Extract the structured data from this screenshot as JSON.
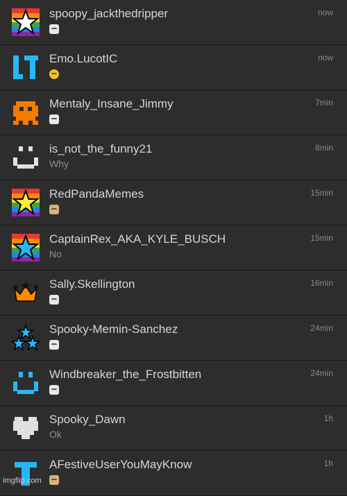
{
  "conversations": [
    {
      "name": "spoopy_jackthedripper",
      "preview": "",
      "preview_emoji": "face-emoji",
      "time": "now",
      "avatar": "rainbow-star-white-icon"
    },
    {
      "name": "Emo.LucotIC",
      "preview": "",
      "preview_emoji": "kiss-emoji",
      "time": "now",
      "avatar": "lt-letters-icon"
    },
    {
      "name": "Mentaly_Insane_Jimmy",
      "preview": "",
      "preview_emoji": "face-emoji",
      "time": "7min",
      "avatar": "orange-ghost-icon"
    },
    {
      "name": "is_not_the_funny21",
      "preview": "Why",
      "preview_emoji": "",
      "time": "8min",
      "avatar": "smile-face-icon"
    },
    {
      "name": "RedPandaMemes",
      "preview": "",
      "preview_emoji": "dog-emoji",
      "time": "15min",
      "avatar": "rainbow-star-yellow-icon"
    },
    {
      "name": "CaptainRex_AKA_KYLE_BUSCH",
      "preview": "No",
      "preview_emoji": "",
      "time": "15min",
      "avatar": "rainbow-star-blue-icon"
    },
    {
      "name": "Sally.Skellington",
      "preview": "",
      "preview_emoji": "face-emoji",
      "time": "16min",
      "avatar": "crown-icon"
    },
    {
      "name": "Spooky-Memin-Sanchez",
      "preview": "",
      "preview_emoji": "face-emoji",
      "time": "24min",
      "avatar": "triple-star-icon"
    },
    {
      "name": "Windbreaker_the_Frostbitten",
      "preview": "",
      "preview_emoji": "face-emoji",
      "time": "24min",
      "avatar": "blue-smile-face-icon"
    },
    {
      "name": "Spooky_Dawn",
      "preview": "Ok",
      "preview_emoji": "",
      "time": "1h",
      "avatar": "heart-icon"
    },
    {
      "name": "AFestiveUserYouMayKnow",
      "preview": "",
      "preview_emoji": "dog-emoji",
      "time": "1h",
      "avatar": "blue-pixel-icon"
    }
  ],
  "watermark": "imgflip.com",
  "colors": {
    "background": "#2b2b2b",
    "name": "#d6d6d6",
    "preview": "#8f8f8f",
    "time": "#8a8a8a"
  }
}
